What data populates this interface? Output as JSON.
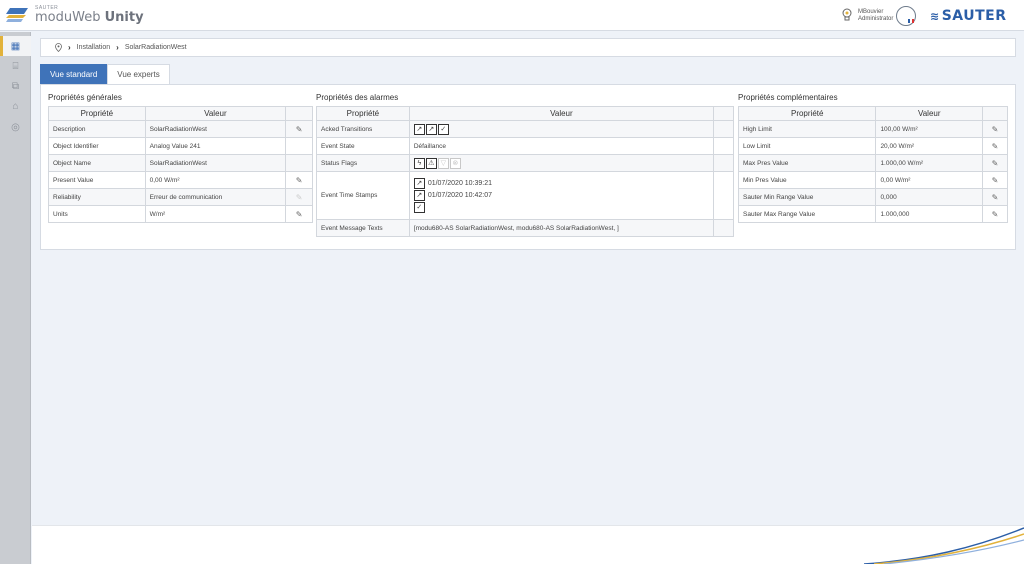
{
  "header": {
    "brand_small": "SAUTER",
    "brand_light": "moduWeb",
    "brand_bold": "Unity",
    "user_name": "MBouvier",
    "user_role": "Administrator",
    "company_logo": "SAUTER",
    "icons": [
      "sauter-logo-icon",
      "lightbulb-icon",
      "avatar-gauge-icon"
    ]
  },
  "rail": {
    "items": [
      {
        "icon": "building-icon",
        "label": "▦"
      },
      {
        "icon": "tree-icon",
        "label": "⌸"
      },
      {
        "icon": "network-icon",
        "label": "⧉"
      },
      {
        "icon": "folder-icon",
        "label": "⌂"
      },
      {
        "icon": "clock-icon",
        "label": "◎"
      }
    ]
  },
  "breadcrumb": {
    "items": [
      "Installation",
      "SolarRadiationWest"
    ]
  },
  "tabs": [
    {
      "label": "Vue standard",
      "active": true
    },
    {
      "label": "Vue experts",
      "active": false
    }
  ],
  "general": {
    "title": "Propriétés générales",
    "col_prop": "Propriété",
    "col_val": "Valeur",
    "rows": [
      {
        "prop": "Description",
        "val": "SolarRadiationWest",
        "edit": "on"
      },
      {
        "prop": "Object Identifier",
        "val": "Analog Value 241",
        "edit": ""
      },
      {
        "prop": "Object Name",
        "val": "SolarRadiationWest",
        "edit": ""
      },
      {
        "prop": "Present Value",
        "val": "0,00 W/m²",
        "edit": "on"
      },
      {
        "prop": "Reliability",
        "val": "Erreur de communication",
        "edit": "dim"
      },
      {
        "prop": "Units",
        "val": "W/m²",
        "edit": "on"
      }
    ]
  },
  "alarms": {
    "title": "Propriétés des alarmes",
    "col_prop": "Propriété",
    "col_val": "Valeur",
    "acked_label": "Acked Transitions",
    "event_state_label": "Event State",
    "event_state_val": "Défaillance",
    "status_flags_label": "Status Flags",
    "timestamps_label": "Event Time Stamps",
    "timestamps": [
      "01/07/2020 10:39:21",
      "01/07/2020 10:42:07",
      ""
    ],
    "message_label": "Event Message Texts",
    "message_val": "[modu680-AS SolarRadiationWest, modu680-AS SolarRadiationWest, ]"
  },
  "complementary": {
    "title": "Propriétés complémentaires",
    "col_prop": "Propriété",
    "col_val": "Valeur",
    "rows": [
      {
        "prop": "High Limit",
        "val": "100,00 W/m²"
      },
      {
        "prop": "Low Limit",
        "val": "20,00 W/m²"
      },
      {
        "prop": "Max Pres Value",
        "val": "1.000,00 W/m²"
      },
      {
        "prop": "Min Pres Value",
        "val": "0,00 W/m²"
      },
      {
        "prop": "Sauter Min Range Value",
        "val": "0,000"
      },
      {
        "prop": "Sauter Max Range Value",
        "val": "1.000,000"
      }
    ]
  },
  "colors": {
    "accent": "#3f73b9",
    "rail_highlight": "#e2b23b",
    "background": "#eef2f8"
  }
}
